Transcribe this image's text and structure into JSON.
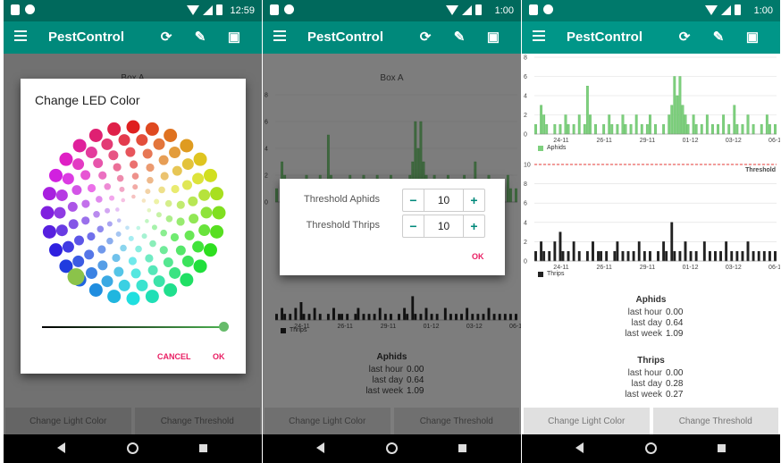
{
  "app": {
    "title": "PestControl",
    "icons": {
      "menu": "menu-icon",
      "refresh": "refresh-icon",
      "edit": "edit-icon",
      "delete": "delete-icon"
    }
  },
  "screens": [
    {
      "time": "12:59"
    },
    {
      "time": "1:00"
    },
    {
      "time": "1:00"
    }
  ],
  "box_title": "Box A",
  "threshold_label": "Threshold",
  "charts": {
    "x_ticks": [
      "24-11",
      "26-11",
      "29-11",
      "01-12",
      "03-12",
      "06-12"
    ],
    "aphids_legend": "Aphids",
    "thrips_legend": "Thrips",
    "aphids_y_ticks": [
      "0",
      "2",
      "4",
      "6",
      "8"
    ],
    "thrips_y_ticks": [
      "0",
      "2",
      "4",
      "6",
      "8",
      "10"
    ],
    "threshold_value": 10
  },
  "chart_data": [
    {
      "type": "bar",
      "series": [
        {
          "name": "Aphids",
          "values": [
            1,
            0,
            3,
            2,
            1,
            0,
            0,
            1,
            0,
            1,
            0,
            2,
            1,
            0,
            1,
            0,
            2,
            0,
            1,
            5,
            2,
            0,
            1,
            0,
            0,
            1,
            0,
            2,
            1,
            0,
            1,
            0,
            2,
            1,
            0,
            1,
            0,
            2,
            0,
            1,
            0,
            1,
            2,
            0,
            1,
            0,
            0,
            1,
            0,
            2,
            3,
            6,
            4,
            6,
            3,
            2,
            1,
            0,
            2,
            1,
            0,
            1,
            0,
            2,
            0,
            1,
            0,
            1,
            0,
            2,
            0,
            1,
            0,
            3,
            1,
            0,
            1,
            0,
            2,
            0,
            1,
            0,
            0,
            1,
            0,
            2,
            1,
            0,
            1
          ]
        }
      ],
      "ylim": [
        0,
        8
      ],
      "color": "#7ed07e"
    },
    {
      "type": "bar",
      "series": [
        {
          "name": "Thrips",
          "values": [
            1,
            0,
            2,
            1,
            0,
            1,
            0,
            2,
            0,
            3,
            1,
            0,
            1,
            0,
            2,
            0,
            1,
            0,
            0,
            1,
            0,
            2,
            0,
            1,
            1,
            0,
            1,
            0,
            0,
            1,
            2,
            0,
            1,
            0,
            1,
            0,
            1,
            0,
            2,
            0,
            1,
            0,
            1,
            0,
            0,
            1,
            0,
            2,
            1,
            0,
            4,
            1,
            0,
            1,
            0,
            2,
            0,
            1,
            0,
            1,
            0,
            0,
            2,
            0,
            1,
            0,
            1,
            0,
            1,
            0,
            2,
            0,
            1,
            0,
            1,
            0,
            1,
            0,
            2,
            0,
            1,
            0,
            1,
            0,
            1,
            0,
            1,
            0,
            1
          ]
        }
      ],
      "ylim": [
        0,
        10
      ],
      "threshold": 10,
      "color": "#222222"
    }
  ],
  "stats": {
    "aphids": {
      "title": "Aphids",
      "last_hour_label": "last hour",
      "last_hour": "0.00",
      "last_day_label": "last day",
      "last_day": "0.64",
      "last_week_label": "last week",
      "last_week": "1.09"
    },
    "thrips": {
      "title": "Thrips",
      "last_hour_label": "last hour",
      "last_hour": "0.00",
      "last_day_label": "last day",
      "last_day": "0.28",
      "last_week_label": "last week",
      "last_week": "0.27"
    }
  },
  "buttons": {
    "change_light": "Change Light Color",
    "change_threshold": "Change Threshold"
  },
  "led_dialog": {
    "title": "Change LED Color",
    "cancel": "CANCEL",
    "ok": "OK"
  },
  "threshold_dialog": {
    "aphids_label": "Threshold Aphids",
    "thrips_label": "Threshold Thrips",
    "aphids_value": "10",
    "thrips_value": "10",
    "minus": "−",
    "plus": "+",
    "ok": "OK"
  },
  "colors": {
    "primary": "#00897b",
    "primary_dark": "#00695c",
    "accent": "#e91e63",
    "aphids": "#7ed07e",
    "thrips": "#222222",
    "threshold_line": "#e53935"
  }
}
